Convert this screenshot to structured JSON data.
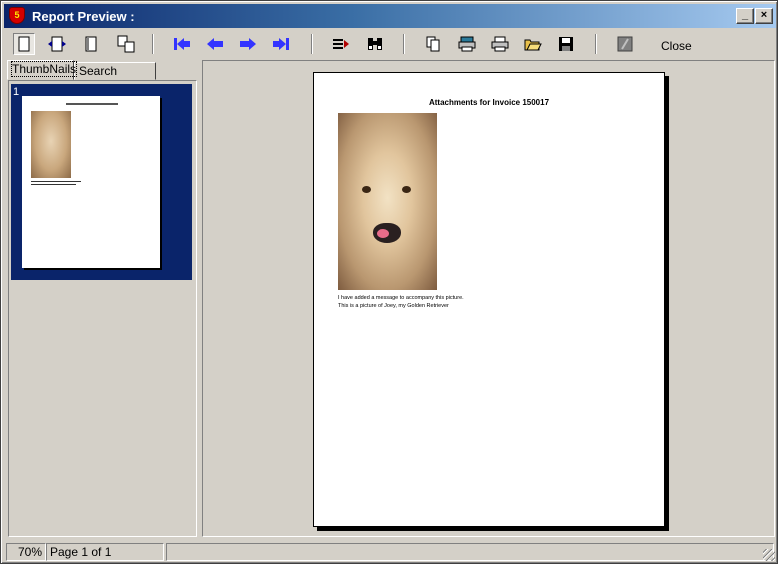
{
  "window": {
    "title": "Report Preview :",
    "app_icon": "report-app-icon",
    "controls": {
      "minimize": "_",
      "maximize": "□",
      "close": "×"
    }
  },
  "toolbar": {
    "buttons": [
      {
        "name": "single-page-view",
        "icon": "page-icon",
        "pressed": true
      },
      {
        "name": "page-width-view",
        "icon": "page-width-icon"
      },
      {
        "name": "full-page-view",
        "icon": "full-page-icon"
      },
      {
        "name": "multi-page-view",
        "icon": "multi-page-icon"
      },
      {
        "name": "first-page",
        "icon": "first-page-icon"
      },
      {
        "name": "previous-page",
        "icon": "previous-page-icon"
      },
      {
        "name": "next-page",
        "icon": "next-page-icon"
      },
      {
        "name": "last-page",
        "icon": "last-page-icon"
      },
      {
        "name": "goto-page",
        "icon": "goto-page-icon"
      },
      {
        "name": "find",
        "icon": "binoculars-icon"
      },
      {
        "name": "copy",
        "icon": "copy-icon"
      },
      {
        "name": "print-setup",
        "icon": "printer-setup-icon"
      },
      {
        "name": "print",
        "icon": "printer-icon"
      },
      {
        "name": "open",
        "icon": "folder-open-icon"
      },
      {
        "name": "save",
        "icon": "floppy-disk-icon"
      },
      {
        "name": "export",
        "icon": "export-icon"
      }
    ],
    "close_label": "Close"
  },
  "tabs": [
    {
      "label": "ThumbNails",
      "active": true
    },
    {
      "label": "Search Results",
      "active": false
    }
  ],
  "thumbnails": [
    {
      "page_number": "1",
      "selected": true
    }
  ],
  "preview": {
    "page_title": "Attachments for Invoice 150017",
    "caption_lines": [
      "I have added a message to accompany this picture.",
      "This is a picture of Joey, my Golden Retriever"
    ]
  },
  "status": {
    "zoom": "70%",
    "page_info": "Page 1 of 1"
  },
  "colors": {
    "title_gradient_start": "#0a246a",
    "selection": "#0a246a",
    "nav_arrow": "#3333ff",
    "chrome": "#d4d0c8"
  }
}
